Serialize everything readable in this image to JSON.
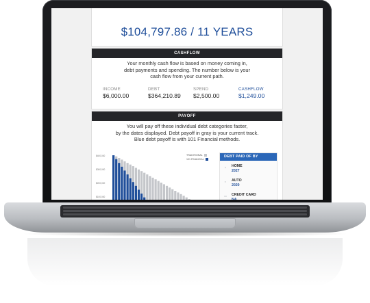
{
  "summary": {
    "value": "$104,797.86 / 11 YEARS"
  },
  "cashflow": {
    "title": "CASHFLOW",
    "description": [
      "Your monthly cash flow is based on money coming in,",
      "debt payments and spending. The number below is your",
      "cash flow from your current path."
    ],
    "stats": [
      {
        "label": "INCOME",
        "value": "$6,000.00"
      },
      {
        "label": "DEBT",
        "value": "$364,210.89"
      },
      {
        "label": "SPEND",
        "value": "$2,500.00"
      },
      {
        "label": "CASHFLOW",
        "value": "$1,249.00"
      }
    ]
  },
  "payoff": {
    "title": "PAYOFF",
    "description": [
      "You will pay off these individual debt categories faster,",
      "by the dates displayed. Debt payoff in gray is your current track.",
      "Blue debt payoff is with 101 Financial methods."
    ],
    "legend": {
      "traditional": "TRADITIONAL",
      "financial": "101 FINANCIAL"
    },
    "panel_title": "DEBT PAID OF BY",
    "items": [
      {
        "name": "HOME",
        "year": "2027",
        "icon": "home-icon"
      },
      {
        "name": "AUTO",
        "year": "2020",
        "icon": "car-icon"
      },
      {
        "name": "CREDIT CARD",
        "year": "NA",
        "icon": "credit-card-icon"
      }
    ]
  },
  "colors": {
    "accent_blue": "#1f4e9a",
    "panel_blue": "#2b67b8",
    "bar_gray": "#c4c6ca",
    "header_dark": "#242528"
  },
  "chart_data": {
    "type": "bar",
    "series": [
      {
        "name": "TRADITIONAL",
        "values": [
          100,
          98,
          95,
          92,
          89,
          86,
          83,
          80,
          77,
          74,
          71,
          68,
          65,
          62,
          59,
          56,
          53,
          50,
          47,
          44,
          41,
          38,
          35,
          32,
          29,
          26,
          23,
          20,
          17,
          14
        ]
      },
      {
        "name": "101 FINANCIAL",
        "values": [
          100,
          93,
          86,
          79,
          72,
          65,
          58,
          51,
          44,
          37,
          30,
          23
        ]
      }
    ],
    "yticks": [
      "$400,000",
      "$300,000",
      "$200,000",
      "$100,000"
    ]
  }
}
